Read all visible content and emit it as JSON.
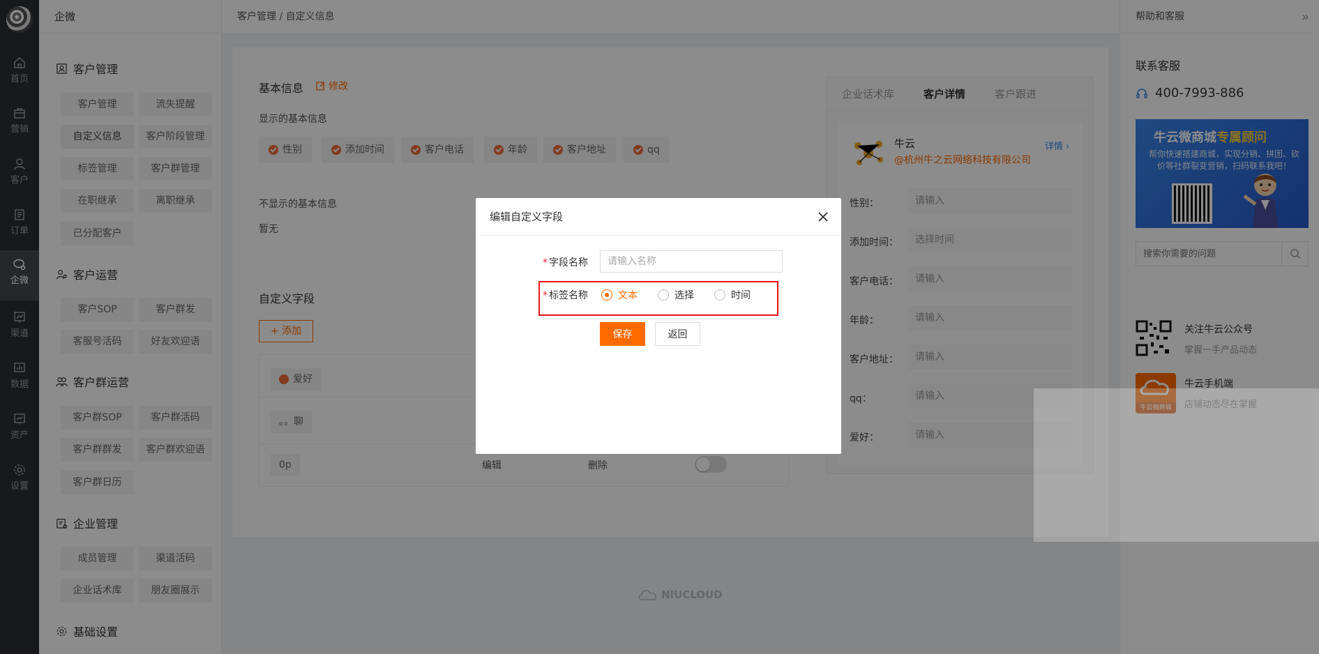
{
  "rail": {
    "items": [
      {
        "label": "首页",
        "icon": "home-icon"
      },
      {
        "label": "营销",
        "icon": "bag-icon"
      },
      {
        "label": "客户",
        "icon": "user-icon"
      },
      {
        "label": "订单",
        "icon": "order-icon"
      },
      {
        "label": "企微",
        "icon": "wecom-icon"
      },
      {
        "label": "渠道",
        "icon": "chart-icon"
      },
      {
        "label": "数据",
        "icon": "data-icon"
      },
      {
        "label": "资产",
        "icon": "asset-icon"
      },
      {
        "label": "设置",
        "icon": "gear-icon"
      }
    ],
    "active": "企微"
  },
  "menu": {
    "brand": "企微",
    "groups": [
      {
        "title": "客户管理",
        "items": [
          "客户管理",
          "流失提醒",
          "自定义信息",
          "客户阶段管理",
          "标签管理",
          "客户群管理",
          "在职继承",
          "离职继承",
          "已分配客户"
        ]
      },
      {
        "title": "客户运营",
        "items": [
          "客户SOP",
          "客户群发",
          "客服号活码",
          "好友欢迎语"
        ]
      },
      {
        "title": "客户群运营",
        "items": [
          "客户群SOP",
          "客户群活码",
          "客户群群发",
          "客户群欢迎语",
          "客户群日历"
        ]
      },
      {
        "title": "企业管理",
        "items": [
          "成员管理",
          "渠道活码",
          "企业话术库",
          "朋友圈展示"
        ]
      },
      {
        "title": "基础设置",
        "items": []
      }
    ]
  },
  "header": {
    "breadcrumb": "客户管理 / 自定义信息"
  },
  "basic": {
    "title": "基本信息",
    "edit": "修改",
    "shown_label": "显示的基本信息",
    "shown": [
      "性别",
      "添加时间",
      "客户电话",
      "年龄",
      "客户地址",
      "qq"
    ],
    "hidden_label": "不显示的基本信息",
    "hidden_value": "暂无"
  },
  "custom": {
    "title": "自定义字段",
    "add": "+ 添加",
    "rows": [
      {
        "name": "爱好",
        "checked": true
      },
      {
        "name": "。。聊",
        "checked": false
      },
      {
        "name": "0p",
        "checked": false,
        "edit": "编辑",
        "delete": "删除"
      }
    ]
  },
  "preview": {
    "tabs": [
      "企业话术库",
      "客户详情",
      "客户跟进"
    ],
    "active_tab": "客户详情",
    "name": "牛云",
    "company": "@杭州牛之云网络科技有限公司",
    "detail": "详情",
    "fields": [
      {
        "label": "性别：",
        "value": "请输入"
      },
      {
        "label": "添加时间：",
        "value": "选择时间"
      },
      {
        "label": "客户电话：",
        "value": "请输入"
      },
      {
        "label": "年龄：",
        "value": "请输入"
      },
      {
        "label": "客户地址：",
        "value": "请输入"
      },
      {
        "label": "qq：",
        "value": "请输入"
      },
      {
        "label": "爱好：",
        "value": "请输入"
      }
    ]
  },
  "help": {
    "title": "帮助和客服",
    "contact_title": "联系客服",
    "phone": "400-7993-886",
    "banner_title_a": "牛云微商城",
    "banner_title_b": "专属顾问",
    "banner_text": "帮你快速搭建商城，实现分销、拼团、砍价等社群裂变营销，扫码联系我吧！",
    "search_placeholder": "搜索你需要的问题",
    "follow_title": "关注牛云公众号",
    "follow_sub": "掌握一手产品动态",
    "app_title": "牛云手机端",
    "app_sub": "店铺动态尽在掌握",
    "app_badge": "牛云微商城"
  },
  "footer": {
    "logo": "NIUCLOUD"
  },
  "modal": {
    "title": "编辑自定义字段",
    "field_label": "字段名称",
    "field_placeholder": "请输入名称",
    "type_label": "标签名称",
    "options": [
      "文本",
      "选择",
      "时间"
    ],
    "selected": "文本",
    "save": "保存",
    "back": "返回"
  },
  "colors": {
    "accent": "#ff6a00",
    "highlight_frame": "#e8131b",
    "rail_bg": "#2d2f33"
  }
}
